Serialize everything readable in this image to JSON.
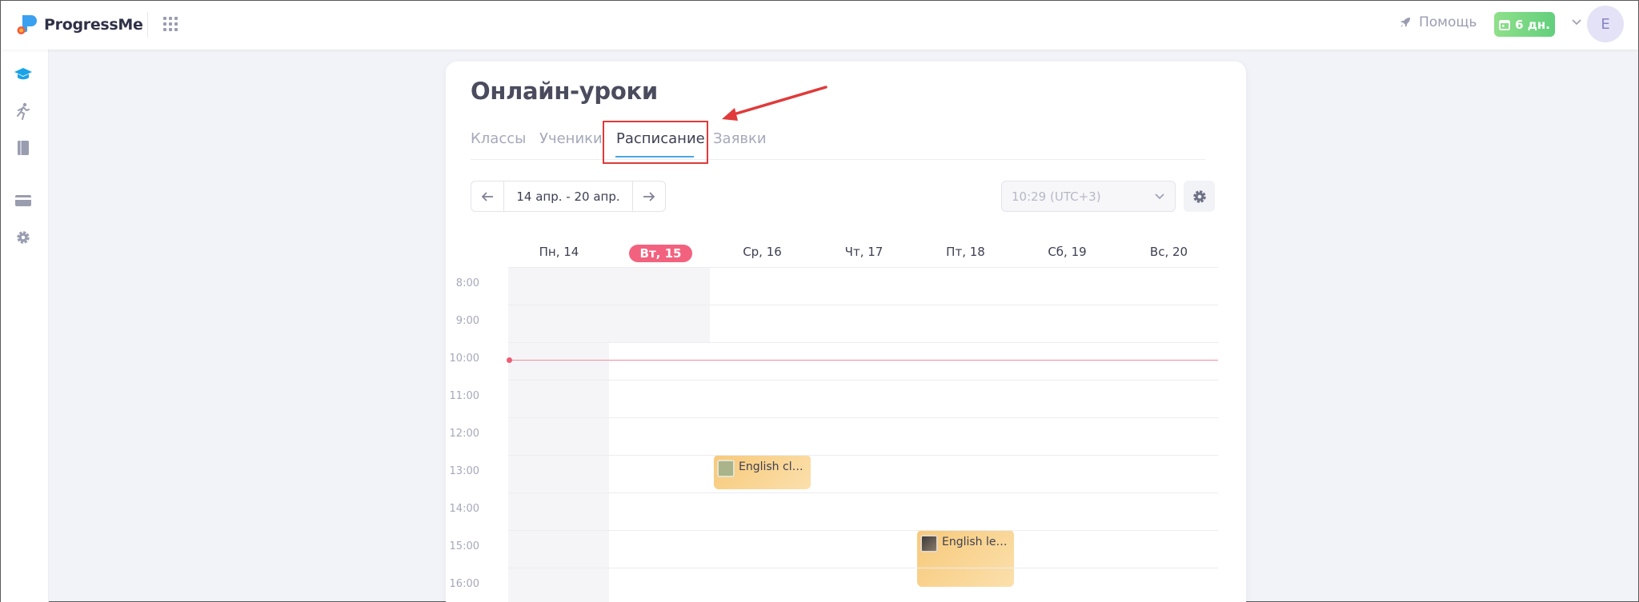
{
  "app": {
    "name": "ProgressMe"
  },
  "topbar": {
    "help_label": "Помощь",
    "days_badge": "6 дн.",
    "avatar_letter": "E"
  },
  "sidebar": {
    "items": [
      "graduation-cap-icon",
      "running-person-icon",
      "book-icon",
      "card-icon",
      "gear-icon"
    ]
  },
  "page": {
    "title": "Онлайн-уроки",
    "tabs": [
      {
        "label": "Классы",
        "active": false
      },
      {
        "label": "Ученики",
        "active": false
      },
      {
        "label": "Расписание",
        "active": true
      },
      {
        "label": "Заявки",
        "active": false
      }
    ]
  },
  "week_nav": {
    "range": "14 апр. - 20 апр."
  },
  "timezone": {
    "value": "10:29 (UTC+3)"
  },
  "calendar": {
    "days": [
      {
        "label": "Пн, 14",
        "today": false
      },
      {
        "label": "Вт, 15",
        "today": true
      },
      {
        "label": "Ср, 16",
        "today": false
      },
      {
        "label": "Чт, 17",
        "today": false
      },
      {
        "label": "Пт, 18",
        "today": false
      },
      {
        "label": "Сб, 19",
        "today": false
      },
      {
        "label": "Вс, 20",
        "today": false
      }
    ],
    "hours": [
      "8:00",
      "9:00",
      "10:00",
      "11:00",
      "12:00",
      "13:00",
      "14:00",
      "15:00",
      "16:00"
    ],
    "current_time": "10:29",
    "events": [
      {
        "title": "English clas...",
        "day": "Ср, 16",
        "start": "13:00",
        "end": "13:55"
      },
      {
        "title": "English less...",
        "day": "Пт, 18",
        "start": "15:00",
        "end": "16:30"
      }
    ]
  },
  "colors": {
    "accent": "#4aa6e6",
    "today": "#f2627f",
    "event": "#f7c97a",
    "badge": "#62cf7d"
  }
}
